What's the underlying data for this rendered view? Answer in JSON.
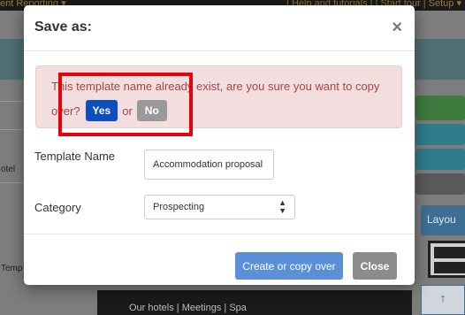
{
  "background": {
    "nav_left": "ent  Reporting ▾",
    "nav_right": "| Help and tutorials | | Start tour |  Setup ▾",
    "side_text_1": "otel",
    "side_text_2": "Temp",
    "layout_label": "Layou",
    "arrow_glyph": "↑",
    "footer_text": "Our hotels  |  Meetings  |  Spa"
  },
  "modal": {
    "title": "Save as:",
    "close_glyph": "×",
    "alert": {
      "line1": "This template name already exist, are you sure you want to copy",
      "line2_prefix": "over?",
      "yes_label": "Yes",
      "or_text": "or",
      "no_label": "No"
    },
    "template_name_label": "Template Name",
    "template_name_value": "Accommodation proposal",
    "category_label": "Category",
    "category_value": "Prospecting",
    "create_button": "Create or copy over",
    "close_button": "Close"
  },
  "colors": {
    "alert_bg": "#f2dede",
    "alert_text": "#a94442",
    "yes_btn": "#0d4fbf",
    "create_btn": "#5b8fd8",
    "highlight": "#e8000a"
  }
}
